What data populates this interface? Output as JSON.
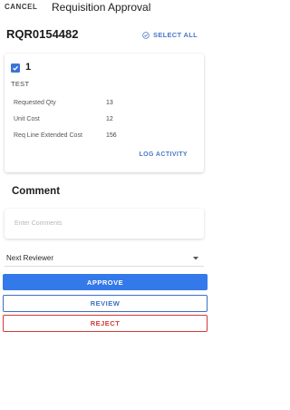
{
  "header": {
    "cancel_label": "CANCEL",
    "title": "Requisition Approval"
  },
  "requisition": {
    "number": "RQR0154482",
    "select_all_label": "SELECT ALL"
  },
  "line_item": {
    "checked": true,
    "line_number": "1",
    "description": "TEST",
    "details": [
      {
        "label": "Requested Qty",
        "value": "13"
      },
      {
        "label": "Unit Cost",
        "value": "12"
      },
      {
        "label": "Req Line Extended Cost",
        "value": "156"
      }
    ],
    "log_activity_label": "LOG ACTIVITY"
  },
  "comment": {
    "title": "Comment",
    "placeholder": "Enter Comments",
    "value": ""
  },
  "next_reviewer": {
    "label": "Next Reviewer"
  },
  "actions": {
    "approve_label": "APPROVE",
    "review_label": "REVIEW",
    "reject_label": "REJECT"
  },
  "colors": {
    "accent": "#3479ea",
    "link": "#4a78c7",
    "reject": "#d23b3b"
  },
  "icons": {
    "select_all": "check-circle-icon",
    "line_checkbox": "checkbox-checked-icon",
    "dropdown": "caret-down-icon"
  }
}
